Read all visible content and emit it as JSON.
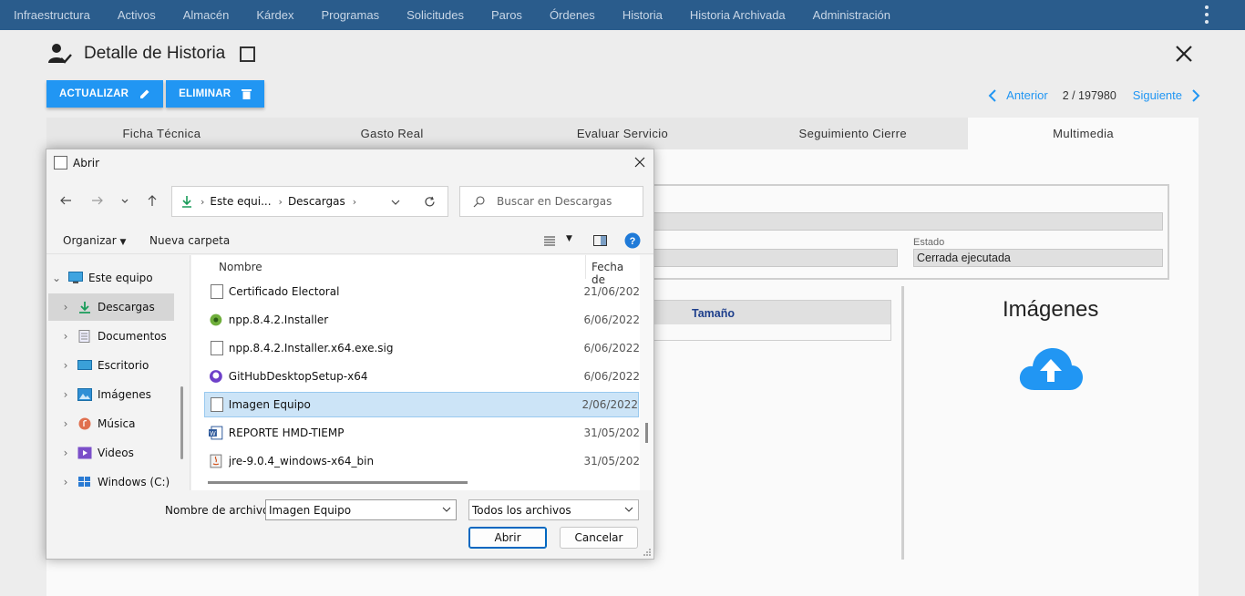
{
  "topnav": {
    "items": [
      "Infraestructura",
      "Activos",
      "Almacén",
      "Kárdex",
      "Programas",
      "Solicitudes",
      "Paros",
      "Órdenes",
      "Historia",
      "Historia Archivada",
      "Administración"
    ]
  },
  "page": {
    "title": "Detalle de Historia",
    "update_label": "ACTUALIZAR",
    "delete_label": "ELIMINAR",
    "pager": {
      "prev": "Anterior",
      "count": "2 / 197980",
      "next": "Siguiente"
    },
    "tabs": [
      "Ficha Técnica",
      "Gasto Real",
      "Evaluar Servicio",
      "Seguimiento Cierre",
      "Multimedia"
    ],
    "active_tab": "Multimedia",
    "estado_label": "Estado",
    "estado_value": "Cerrada ejecutada",
    "table_header": "Tamaño",
    "images_title": "Imágenes"
  },
  "dialog": {
    "title": "Abrir",
    "address": {
      "seg1": "Este equi...",
      "seg2": "Descargas"
    },
    "search_placeholder": "Buscar en Descargas",
    "toolbar": {
      "organize": "Organizar",
      "new_folder": "Nueva carpeta"
    },
    "sidebar": [
      {
        "label": "Este equipo",
        "icon": "monitor-icon"
      },
      {
        "label": "Descargas",
        "icon": "download-icon"
      },
      {
        "label": "Documentos",
        "icon": "document-icon"
      },
      {
        "label": "Escritorio",
        "icon": "desktop-icon"
      },
      {
        "label": "Imágenes",
        "icon": "image-icon"
      },
      {
        "label": "Música",
        "icon": "music-icon"
      },
      {
        "label": "Videos",
        "icon": "video-icon"
      },
      {
        "label": "Windows (C:)",
        "icon": "drive-icon"
      }
    ],
    "columns": {
      "name": "Nombre",
      "date": "Fecha de"
    },
    "files": [
      {
        "name": "Certificado Electoral",
        "date": "21/06/202",
        "icon": "image-file-icon"
      },
      {
        "name": "npp.8.4.2.Installer",
        "date": "6/06/2022",
        "icon": "installer-icon"
      },
      {
        "name": "npp.8.4.2.Installer.x64.exe.sig",
        "date": "6/06/2022",
        "icon": "blank-file-icon"
      },
      {
        "name": "GitHubDesktopSetup-x64",
        "date": "6/06/2022",
        "icon": "github-icon"
      },
      {
        "name": "Imagen Equipo",
        "date": "2/06/2022",
        "icon": "image-file-icon"
      },
      {
        "name": "REPORTE HMD-TIEMP",
        "date": "31/05/202",
        "icon": "word-icon"
      },
      {
        "name": "jre-9.0.4_windows-x64_bin",
        "date": "31/05/202",
        "icon": "java-icon"
      }
    ],
    "selected_file": "Imagen Equipo",
    "filename_label": "Nombre de archivo:",
    "filename_value": "Imagen Equipo",
    "filter_value": "Todos los archivos",
    "open_label": "Abrir",
    "cancel_label": "Cancelar"
  },
  "colors": {
    "nav_bg": "#2a5c8c",
    "accent": "#2196f3",
    "selection": "#cce4f7"
  }
}
